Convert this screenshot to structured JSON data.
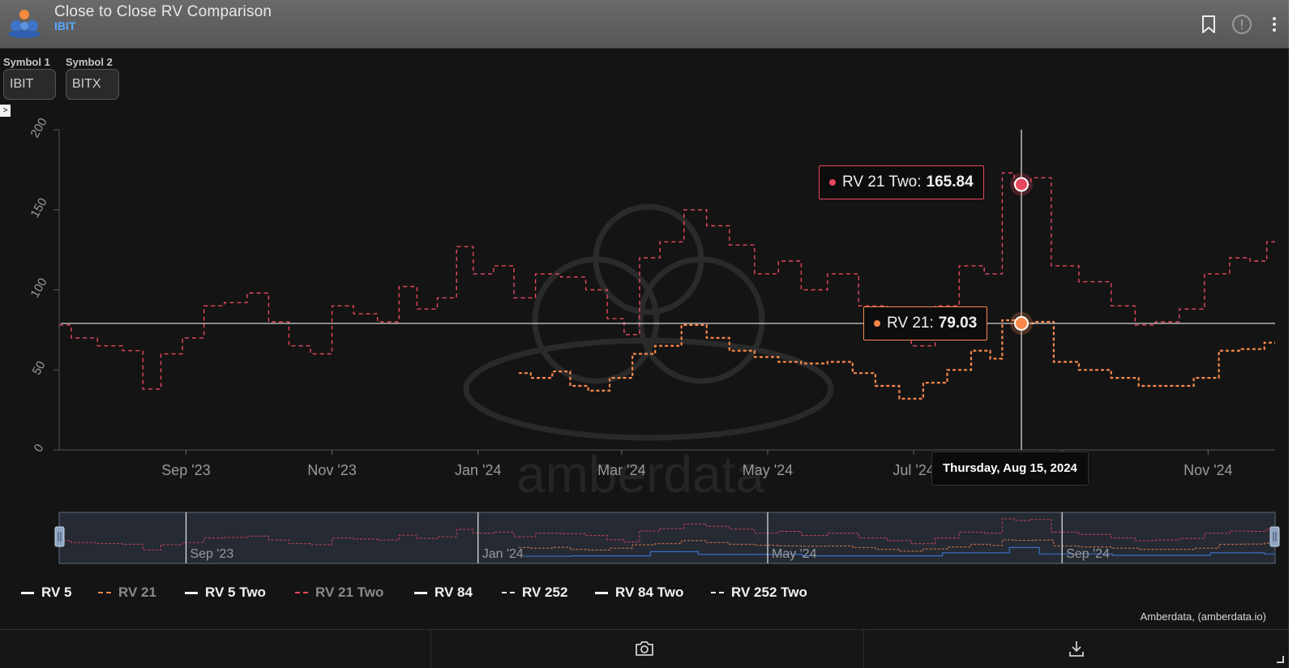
{
  "header": {
    "title": "Close to Close RV Comparison",
    "subtitle": "IBIT",
    "icons": [
      "bookmark-icon",
      "info-icon",
      "more-vertical-icon"
    ]
  },
  "controls": {
    "symbol1": {
      "label": "Symbol 1",
      "value": "IBIT"
    },
    "symbol2": {
      "label": "Symbol 2",
      "value": "BITX"
    },
    "expand_glyph": ">"
  },
  "colors": {
    "rv21_two": "#e8485f",
    "rv21": "#f7884a",
    "rv84": "#3a6fc4",
    "crosshair": "#e6e6e6",
    "axis_label": "#9a9a9a",
    "background": "#141414",
    "header": "#606060",
    "link_blue": "#5aa8ff"
  },
  "chart_data": {
    "type": "line",
    "x_ticks": [
      "Sep '23",
      "Nov '23",
      "Jan '24",
      "Mar '24",
      "May '24",
      "Jul '24",
      "Sep '24",
      "Nov '24"
    ],
    "y_ticks": [
      "0",
      "50",
      "100",
      "150",
      "200"
    ],
    "ylim": [
      0,
      200
    ],
    "xlim": [
      "2023-07-10",
      "2024-11-29"
    ],
    "series": [
      {
        "name": "RV 21 Two",
        "style": "dashed",
        "points": [
          [
            "2023-07-10",
            78
          ],
          [
            "2023-07-20",
            70
          ],
          [
            "2023-08-01",
            65
          ],
          [
            "2023-08-10",
            62
          ],
          [
            "2023-08-18",
            38
          ],
          [
            "2023-08-25",
            60
          ],
          [
            "2023-09-05",
            70
          ],
          [
            "2023-09-12",
            90
          ],
          [
            "2023-09-22",
            92
          ],
          [
            "2023-10-01",
            98
          ],
          [
            "2023-10-10",
            80
          ],
          [
            "2023-10-18",
            65
          ],
          [
            "2023-10-28",
            60
          ],
          [
            "2023-11-05",
            90
          ],
          [
            "2023-11-15",
            85
          ],
          [
            "2023-11-25",
            80
          ],
          [
            "2023-12-03",
            102
          ],
          [
            "2023-12-10",
            88
          ],
          [
            "2023-12-20",
            95
          ],
          [
            "2023-12-26",
            127
          ],
          [
            "2024-01-03",
            110
          ],
          [
            "2024-01-12",
            115
          ],
          [
            "2024-01-20",
            95
          ],
          [
            "2024-01-30",
            110
          ],
          [
            "2024-02-10",
            108
          ],
          [
            "2024-02-20",
            100
          ],
          [
            "2024-02-28",
            82
          ],
          [
            "2024-03-05",
            72
          ],
          [
            "2024-03-12",
            120
          ],
          [
            "2024-03-22",
            130
          ],
          [
            "2024-04-01",
            150
          ],
          [
            "2024-04-10",
            140
          ],
          [
            "2024-04-20",
            128
          ],
          [
            "2024-05-01",
            110
          ],
          [
            "2024-05-10",
            118
          ],
          [
            "2024-05-20",
            100
          ],
          [
            "2024-06-01",
            110
          ],
          [
            "2024-06-15",
            90
          ],
          [
            "2024-06-25",
            78
          ],
          [
            "2024-07-05",
            65
          ],
          [
            "2024-07-15",
            90
          ],
          [
            "2024-07-25",
            115
          ],
          [
            "2024-08-05",
            110
          ],
          [
            "2024-08-09",
            173
          ],
          [
            "2024-08-15",
            165.84
          ],
          [
            "2024-08-23",
            170
          ],
          [
            "2024-09-01",
            115
          ],
          [
            "2024-09-15",
            105
          ],
          [
            "2024-09-28",
            90
          ],
          [
            "2024-10-05",
            78
          ],
          [
            "2024-10-15",
            80
          ],
          [
            "2024-10-25",
            88
          ],
          [
            "2024-11-05",
            110
          ],
          [
            "2024-11-15",
            120
          ],
          [
            "2024-11-22",
            118
          ],
          [
            "2024-11-29",
            130
          ]
        ]
      },
      {
        "name": "RV 21",
        "style": "dashed",
        "points": [
          [
            "2024-01-18",
            48
          ],
          [
            "2024-01-28",
            45
          ],
          [
            "2024-02-05",
            49
          ],
          [
            "2024-02-12",
            40
          ],
          [
            "2024-02-20",
            37
          ],
          [
            "2024-03-01",
            45
          ],
          [
            "2024-03-10",
            60
          ],
          [
            "2024-03-20",
            65
          ],
          [
            "2024-04-01",
            78
          ],
          [
            "2024-04-10",
            70
          ],
          [
            "2024-04-20",
            62
          ],
          [
            "2024-05-01",
            58
          ],
          [
            "2024-05-10",
            55
          ],
          [
            "2024-05-20",
            54
          ],
          [
            "2024-06-01",
            55
          ],
          [
            "2024-06-10",
            48
          ],
          [
            "2024-06-20",
            40
          ],
          [
            "2024-06-30",
            32
          ],
          [
            "2024-07-10",
            42
          ],
          [
            "2024-07-20",
            50
          ],
          [
            "2024-07-30",
            62
          ],
          [
            "2024-08-05",
            57
          ],
          [
            "2024-08-09",
            81
          ],
          [
            "2024-08-15",
            79.03
          ],
          [
            "2024-08-25",
            80
          ],
          [
            "2024-09-01",
            55
          ],
          [
            "2024-09-15",
            50
          ],
          [
            "2024-09-28",
            45
          ],
          [
            "2024-10-08",
            40
          ],
          [
            "2024-10-20",
            40
          ],
          [
            "2024-11-01",
            45
          ],
          [
            "2024-11-10",
            62
          ],
          [
            "2024-11-20",
            63
          ],
          [
            "2024-11-29",
            67
          ]
        ]
      }
    ],
    "crosshair": {
      "date": "Thursday, Aug 15, 2024",
      "x": "2024-08-15",
      "y": 79.03
    },
    "tooltips": [
      {
        "series": "RV 21 Two",
        "label": "RV 21 Two:",
        "value": "165.84"
      },
      {
        "series": "RV 21",
        "label": "RV 21:",
        "value": "79.03"
      }
    ],
    "navigator": {
      "ticks": [
        "Sep '23",
        "Jan '24",
        "May '24",
        "Sep '24"
      ],
      "selection": "full range"
    }
  },
  "legend": [
    {
      "label": "RV 5",
      "style": "solid",
      "active": true
    },
    {
      "label": "RV 21",
      "style": "dashed",
      "active": false,
      "color": "#f7884a"
    },
    {
      "label": "RV 5 Two",
      "style": "solid",
      "active": true
    },
    {
      "label": "RV 21 Two",
      "style": "dashed",
      "active": false,
      "color": "#e8485f"
    },
    {
      "label": "RV 84",
      "style": "solid",
      "active": true
    },
    {
      "label": "RV 252",
      "style": "dashed",
      "active": true
    },
    {
      "label": "RV 84 Two",
      "style": "solid",
      "active": true
    },
    {
      "label": "RV 252 Two",
      "style": "dashed",
      "active": true
    }
  ],
  "watermark": "amberdata",
  "credits": "Amberdata, (amberdata.io)",
  "toolbar": {
    "buttons": [
      "camera-icon",
      "download-icon"
    ]
  }
}
